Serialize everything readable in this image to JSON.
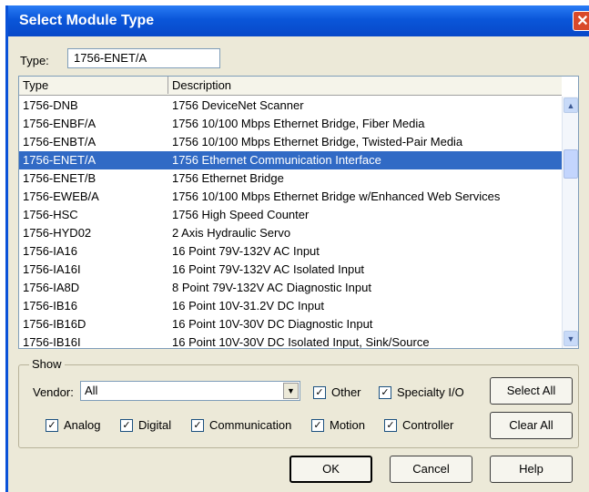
{
  "window": {
    "title": "Select Module Type",
    "close_symbol": "✕"
  },
  "type_field": {
    "label": "Type:",
    "value": "1756-ENET/A"
  },
  "list": {
    "headers": {
      "type": "Type",
      "description": "Description"
    },
    "rows": [
      {
        "type": "1756-DNB",
        "description": "1756 DeviceNet Scanner"
      },
      {
        "type": "1756-ENBF/A",
        "description": "1756 10/100 Mbps Ethernet Bridge, Fiber Media"
      },
      {
        "type": "1756-ENBT/A",
        "description": "1756 10/100 Mbps Ethernet Bridge, Twisted-Pair Media"
      },
      {
        "type": "1756-ENET/A",
        "description": "1756 Ethernet Communication Interface",
        "selected": true
      },
      {
        "type": "1756-ENET/B",
        "description": "1756 Ethernet Bridge"
      },
      {
        "type": "1756-EWEB/A",
        "description": "1756 10/100 Mbps Ethernet Bridge w/Enhanced Web Services"
      },
      {
        "type": "1756-HSC",
        "description": "1756 High Speed Counter"
      },
      {
        "type": "1756-HYD02",
        "description": "2 Axis Hydraulic Servo"
      },
      {
        "type": "1756-IA16",
        "description": "16 Point 79V-132V AC Input"
      },
      {
        "type": "1756-IA16I",
        "description": "16 Point 79V-132V AC Isolated Input"
      },
      {
        "type": "1756-IA8D",
        "description": "8 Point 79V-132V AC Diagnostic Input"
      },
      {
        "type": "1756-IB16",
        "description": "16 Point 10V-31.2V DC Input"
      },
      {
        "type": "1756-IB16D",
        "description": "16 Point 10V-30V DC Diagnostic Input"
      },
      {
        "type": "1756-IB16I",
        "description": "16 Point 10V-30V DC Isolated Input, Sink/Source"
      }
    ],
    "selected_row_color": "#316ac5",
    "scroll_up_icon": "▲",
    "scroll_down_icon": "▼"
  },
  "show": {
    "label": "Show",
    "vendor_label": "Vendor:",
    "vendor_value": "All",
    "dropdown_icon": "▼",
    "check_mark": "✓",
    "checkboxes": [
      {
        "label": "Other",
        "checked": true
      },
      {
        "label": "Specialty I/O",
        "checked": true
      },
      {
        "label": "Analog",
        "checked": true
      },
      {
        "label": "Digital",
        "checked": true
      },
      {
        "label": "Communication",
        "checked": true
      },
      {
        "label": "Motion",
        "checked": true
      },
      {
        "label": "Controller",
        "checked": true
      }
    ],
    "select_all": "Select All",
    "clear_all": "Clear All"
  },
  "buttons": {
    "ok": "OK",
    "cancel": "Cancel",
    "help": "Help"
  },
  "colors": {
    "titlebar": "#0a56d9",
    "dialog_bg": "#ece9d8"
  }
}
